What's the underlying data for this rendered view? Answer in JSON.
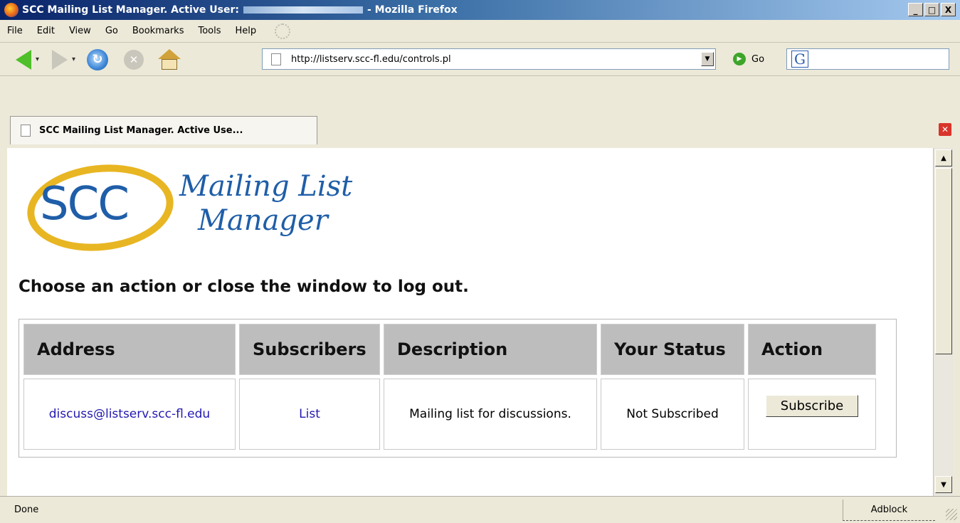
{
  "window": {
    "title_prefix": "SCC Mailing List Manager. Active User:",
    "title_suffix": "- Mozilla Firefox",
    "minimize": "_",
    "maximize": "□",
    "close": "X"
  },
  "menu": [
    "File",
    "Edit",
    "View",
    "Go",
    "Bookmarks",
    "Tools",
    "Help"
  ],
  "toolbar": {
    "url": "http://listserv.scc-fl.edu/controls.pl",
    "go_label": "Go",
    "search_engine_icon": "G"
  },
  "tab": {
    "label": "SCC Mailing List Manager. Active Use..."
  },
  "page": {
    "logo": {
      "acronym": "SCC",
      "line1": "Mailing List",
      "line2": "Manager"
    },
    "heading": "Choose an action or close the window to log out.",
    "table": {
      "headers": [
        "Address",
        "Subscribers",
        "Description",
        "Your Status",
        "Action"
      ],
      "rows": [
        {
          "address": "discuss@listserv.scc-fl.edu",
          "subscribers": "List",
          "description": "Mailing list for discussions.",
          "status": "Not Subscribed",
          "action": "Subscribe"
        }
      ]
    }
  },
  "status": {
    "text": "Done",
    "adblock": "Adblock"
  },
  "colors": {
    "link": "#2218b0",
    "header_bg": "#bdbdbd",
    "brand_blue": "#1f5ea8",
    "brand_gold": "#e8b623"
  }
}
